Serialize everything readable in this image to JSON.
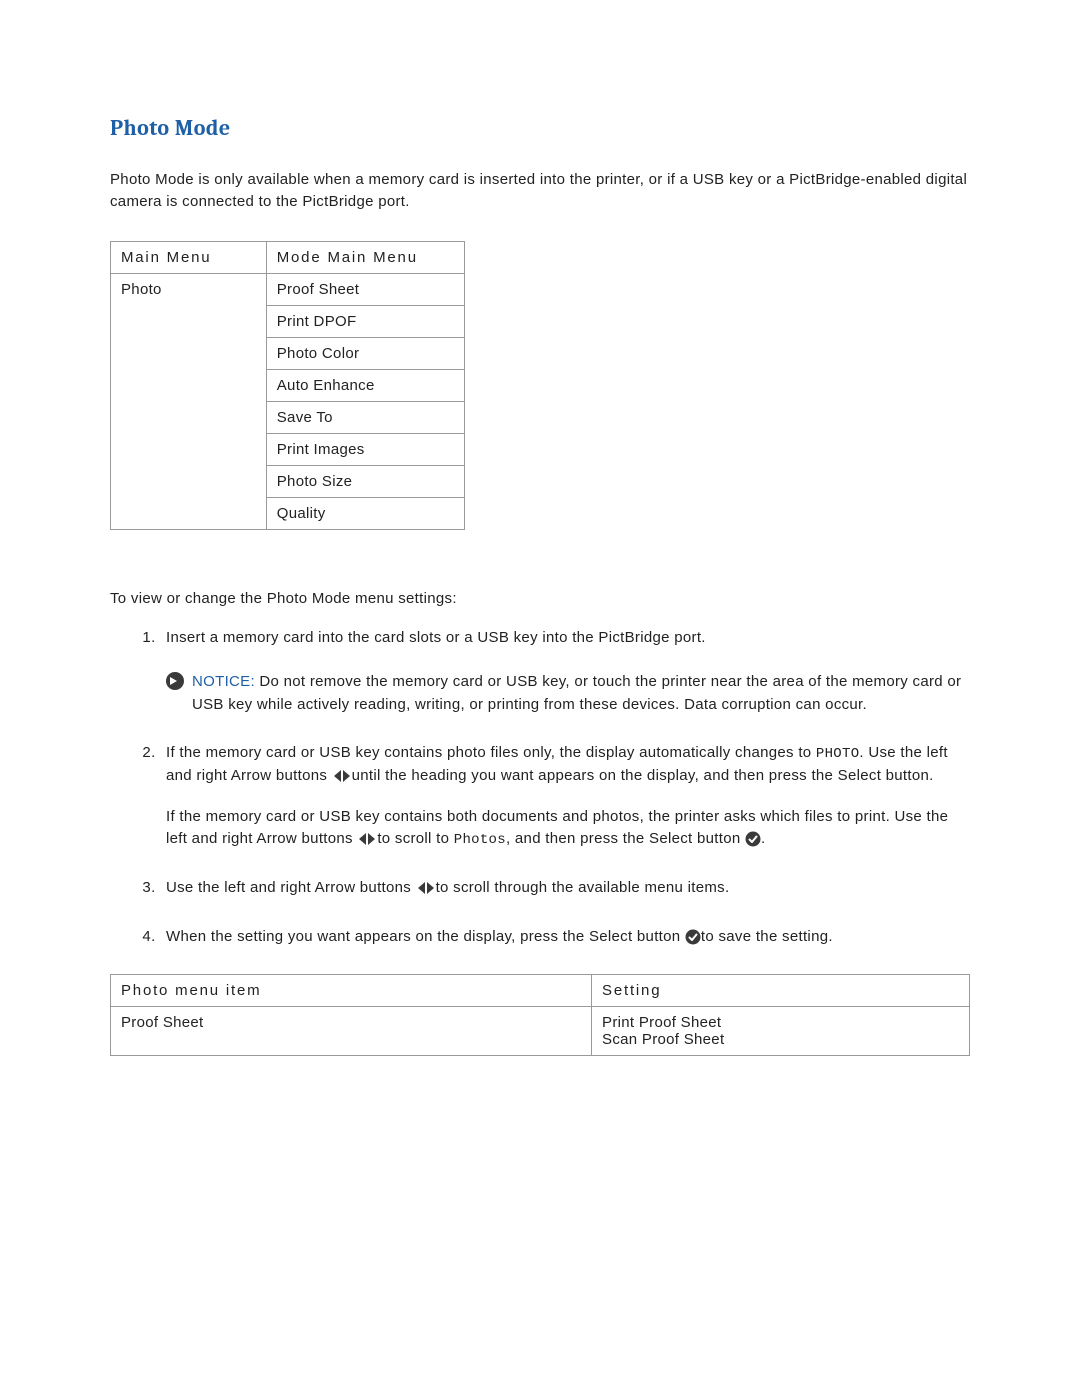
{
  "title": "Photo Mode",
  "intro": "Photo Mode is only available when a memory card is inserted into the printer, or if a USB key or a PictBridge-enabled digital camera is connected to the PictBridge port.",
  "menu_table": {
    "headers": {
      "col1": "Main Menu",
      "col2": "Mode Main Menu"
    },
    "row_label": "Photo",
    "items": [
      "Proof Sheet",
      "Print DPOF",
      "Photo Color",
      "Auto Enhance",
      "Save To",
      "Print Images",
      "Photo Size",
      "Quality"
    ]
  },
  "lead": "To view or change the Photo Mode menu settings:",
  "steps": {
    "s1": {
      "text": "Insert a memory card into the card slots or a USB key into the PictBridge port.",
      "notice_label": "NOTICE:",
      "notice_text": " Do not remove the memory card or USB key, or touch the printer near the area of the memory card or USB key while actively reading, writing, or printing from these devices. Data corruption can occur."
    },
    "s2": {
      "p1a": "If the memory card or USB key contains photo files only, the display automatically changes to ",
      "p1_mono": "PHOTO",
      "p1b": ". Use the left and right Arrow buttons ",
      "p1c": "until the heading you want appears on the display, and then press the Select button.",
      "p2a": "If the memory card or USB key contains both documents and photos, the printer asks which files to print. Use the left and right Arrow buttons ",
      "p2b": "to scroll to ",
      "p2_mono": "Photos",
      "p2c": ", and then press the Select button ",
      "p2d": "."
    },
    "s3": {
      "a": "Use the left and right Arrow buttons ",
      "b": "to scroll through the available menu items."
    },
    "s4": {
      "a": "When the setting you want appears on the display, press the Select button ",
      "b": "to save the setting."
    }
  },
  "settings_table": {
    "headers": {
      "col1": "Photo menu item",
      "col2": "Setting"
    },
    "rows": [
      {
        "item": "Proof Sheet",
        "settings": [
          "Print Proof Sheet",
          "Scan Proof Sheet"
        ]
      }
    ]
  }
}
